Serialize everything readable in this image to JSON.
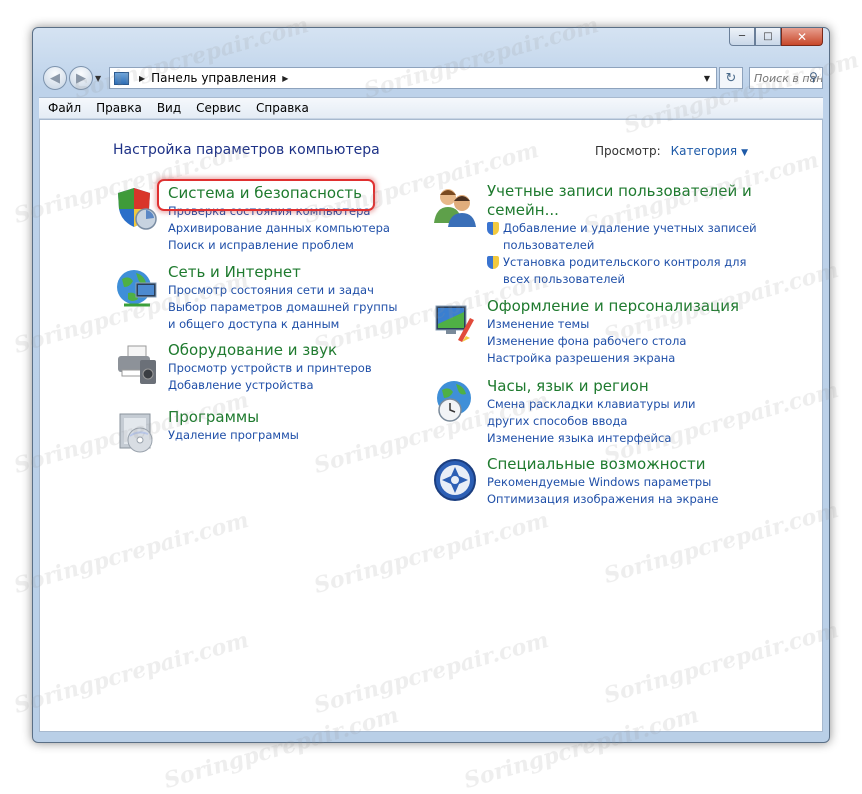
{
  "window": {
    "caption_buttons": {
      "minimize": "minimize-icon",
      "maximize": "maximize-icon",
      "close": "close-icon"
    }
  },
  "address_bar": {
    "path": "Панель управления",
    "search_placeholder": "Поиск в пан..."
  },
  "menu": [
    "Файл",
    "Правка",
    "Вид",
    "Сервис",
    "Справка"
  ],
  "page": {
    "title": "Настройка параметров компьютера",
    "view_label": "Просмотр:",
    "view_value": "Категория"
  },
  "categories_left": [
    {
      "title": "Система и безопасность",
      "links": [
        "Проверка состояния компьютера",
        "Архивирование данных компьютера",
        "Поиск и исправление проблем"
      ]
    },
    {
      "title": "Сеть и Интернет",
      "links": [
        "Просмотр состояния сети и задач",
        "Выбор параметров домашней группы и общего доступа к данным"
      ]
    },
    {
      "title": "Оборудование и звук",
      "links": [
        "Просмотр устройств и принтеров",
        "Добавление устройства"
      ]
    },
    {
      "title": "Программы",
      "links": [
        "Удаление программы"
      ]
    }
  ],
  "categories_right": [
    {
      "title": "Учетные записи пользователей и семейн...",
      "links": [
        "Добавление и удаление учетных записей пользователей",
        "Установка родительского контроля для всех пользователей"
      ]
    },
    {
      "title": "Оформление и персонализация",
      "links": [
        "Изменение темы",
        "Изменение фона рабочего стола",
        "Настройка разрешения экрана"
      ]
    },
    {
      "title": "Часы, язык и регион",
      "links": [
        "Смена раскладки клавиатуры или других способов ввода",
        "Изменение языка интерфейса"
      ]
    },
    {
      "title": "Специальные возможности",
      "links": [
        "Рекомендуемые Windows параметры",
        "Оптимизация изображения на экране"
      ]
    }
  ],
  "watermark": "Soringpcrepair.com",
  "colors": {
    "category_title": "#1e7a2e",
    "link": "#1f4fa8",
    "highlight": "#e03030",
    "page_title": "#1e3287"
  }
}
